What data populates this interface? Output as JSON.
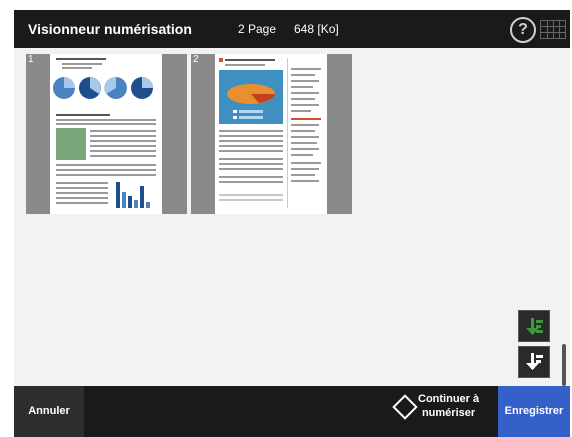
{
  "header": {
    "title": "Visionneur numérisation",
    "page_count": "2 Page",
    "file_size": "648 [Ko]"
  },
  "icons": {
    "help": "?",
    "keyboard": "keyboard-icon"
  },
  "thumbnails": [
    {
      "number": "1"
    },
    {
      "number": "2"
    }
  ],
  "footer": {
    "cancel_label": "Annuler",
    "continue_label": "Continuer à\nnumériser",
    "save_label": "Enregistrer"
  },
  "colors": {
    "save_button": "#3560c9",
    "bar_background": "#1a1a1a",
    "content_background": "#f2f2f2",
    "page_icon_green": "#3a9a3a"
  }
}
